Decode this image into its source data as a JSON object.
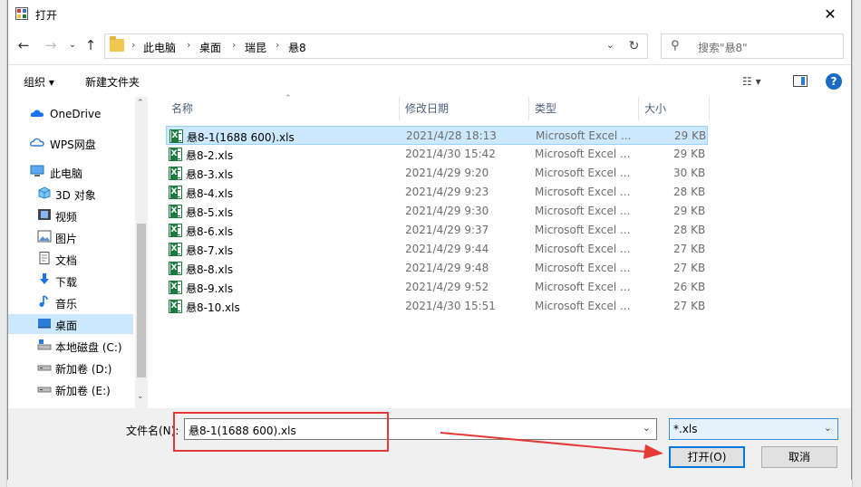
{
  "window": {
    "title": "打开"
  },
  "nav": {
    "breadcrumbs": [
      "此电脑",
      "桌面",
      "瑞昆",
      "悬8"
    ],
    "search_placeholder": "搜索\"悬8\""
  },
  "toolbar": {
    "organize_label": "组织 ▾",
    "new_folder_label": "新建文件夹"
  },
  "sidebar": {
    "items": [
      {
        "label": "OneDrive",
        "icon": "cloud-icon"
      },
      {
        "label": "WPS网盘",
        "icon": "cloud-outline-icon"
      },
      {
        "label": "此电脑",
        "icon": "computer-icon"
      },
      {
        "label": "3D 对象",
        "icon": "3d-object-icon"
      },
      {
        "label": "视频",
        "icon": "video-icon"
      },
      {
        "label": "图片",
        "icon": "picture-icon"
      },
      {
        "label": "文档",
        "icon": "document-icon"
      },
      {
        "label": "下载",
        "icon": "download-icon"
      },
      {
        "label": "音乐",
        "icon": "music-icon"
      },
      {
        "label": "桌面",
        "icon": "desktop-icon"
      },
      {
        "label": "本地磁盘 (C:)",
        "icon": "drive-c-icon"
      },
      {
        "label": "新加卷 (D:)",
        "icon": "drive-icon"
      },
      {
        "label": "新加卷 (E:)",
        "icon": "drive-icon"
      }
    ]
  },
  "files": {
    "columns": {
      "name": "名称",
      "date": "修改日期",
      "type": "类型",
      "size": "大小"
    },
    "rows": [
      {
        "name": "悬8-1(1688 600).xls",
        "date": "2021/4/28 18:13",
        "type": "Microsoft Excel ...",
        "size": "29 KB"
      },
      {
        "name": "悬8-2.xls",
        "date": "2021/4/30 15:42",
        "type": "Microsoft Excel ...",
        "size": "29 KB"
      },
      {
        "name": "悬8-3.xls",
        "date": "2021/4/29 9:20",
        "type": "Microsoft Excel ...",
        "size": "30 KB"
      },
      {
        "name": "悬8-4.xls",
        "date": "2021/4/29 9:23",
        "type": "Microsoft Excel ...",
        "size": "28 KB"
      },
      {
        "name": "悬8-5.xls",
        "date": "2021/4/29 9:30",
        "type": "Microsoft Excel ...",
        "size": "29 KB"
      },
      {
        "name": "悬8-6.xls",
        "date": "2021/4/29 9:37",
        "type": "Microsoft Excel ...",
        "size": "28 KB"
      },
      {
        "name": "悬8-7.xls",
        "date": "2021/4/29 9:44",
        "type": "Microsoft Excel ...",
        "size": "27 KB"
      },
      {
        "name": "悬8-8.xls",
        "date": "2021/4/29 9:48",
        "type": "Microsoft Excel ...",
        "size": "27 KB"
      },
      {
        "name": "悬8-9.xls",
        "date": "2021/4/29 9:52",
        "type": "Microsoft Excel ...",
        "size": "26 KB"
      },
      {
        "name": "悬8-10.xls",
        "date": "2021/4/30 15:51",
        "type": "Microsoft Excel ...",
        "size": "27 KB"
      }
    ]
  },
  "bottom": {
    "filename_label": "文件名(N):",
    "filename_value": "悬8-1(1688 600).xls",
    "filetype_value": "*.xls",
    "open_label": "打开(O)",
    "cancel_label": "取消"
  },
  "colors": {
    "selection": "#cce8ff",
    "accent": "#0078d7",
    "annotation": "#e53935"
  }
}
